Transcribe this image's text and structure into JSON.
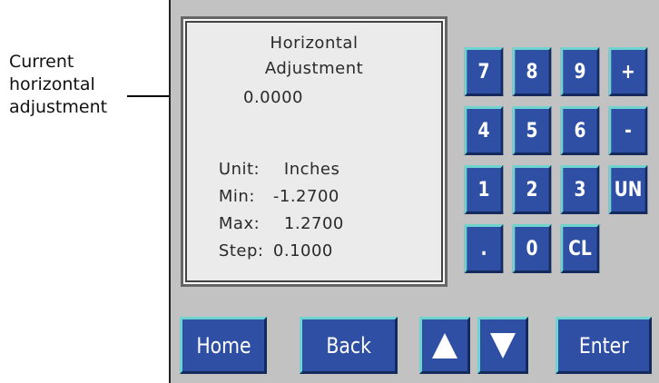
{
  "callout": {
    "text": "Current horizontal adjustment"
  },
  "display": {
    "title_line1": "Horizontal",
    "title_line2": "Adjustment",
    "value": "0.0000",
    "unit_label": "Unit:",
    "unit_value": "Inches",
    "min_label": "Min:",
    "min_value": "-1.2700",
    "max_label": "Max:",
    "max_value": "1.2700",
    "step_label": "Step:",
    "step_value": "0.1000"
  },
  "keypad": {
    "keys": [
      "7",
      "8",
      "9",
      "+",
      "4",
      "5",
      "6",
      "-",
      "1",
      "2",
      "3",
      "UN",
      ".",
      "0",
      "CL"
    ]
  },
  "nav": {
    "home_label": "Home",
    "back_label": "Back",
    "enter_label": "Enter"
  },
  "colors": {
    "button_face": "#2e4fa3",
    "button_highlight": "#6fd3d0",
    "panel": "#c2c2c2",
    "display_bg": "#ebebeb"
  }
}
